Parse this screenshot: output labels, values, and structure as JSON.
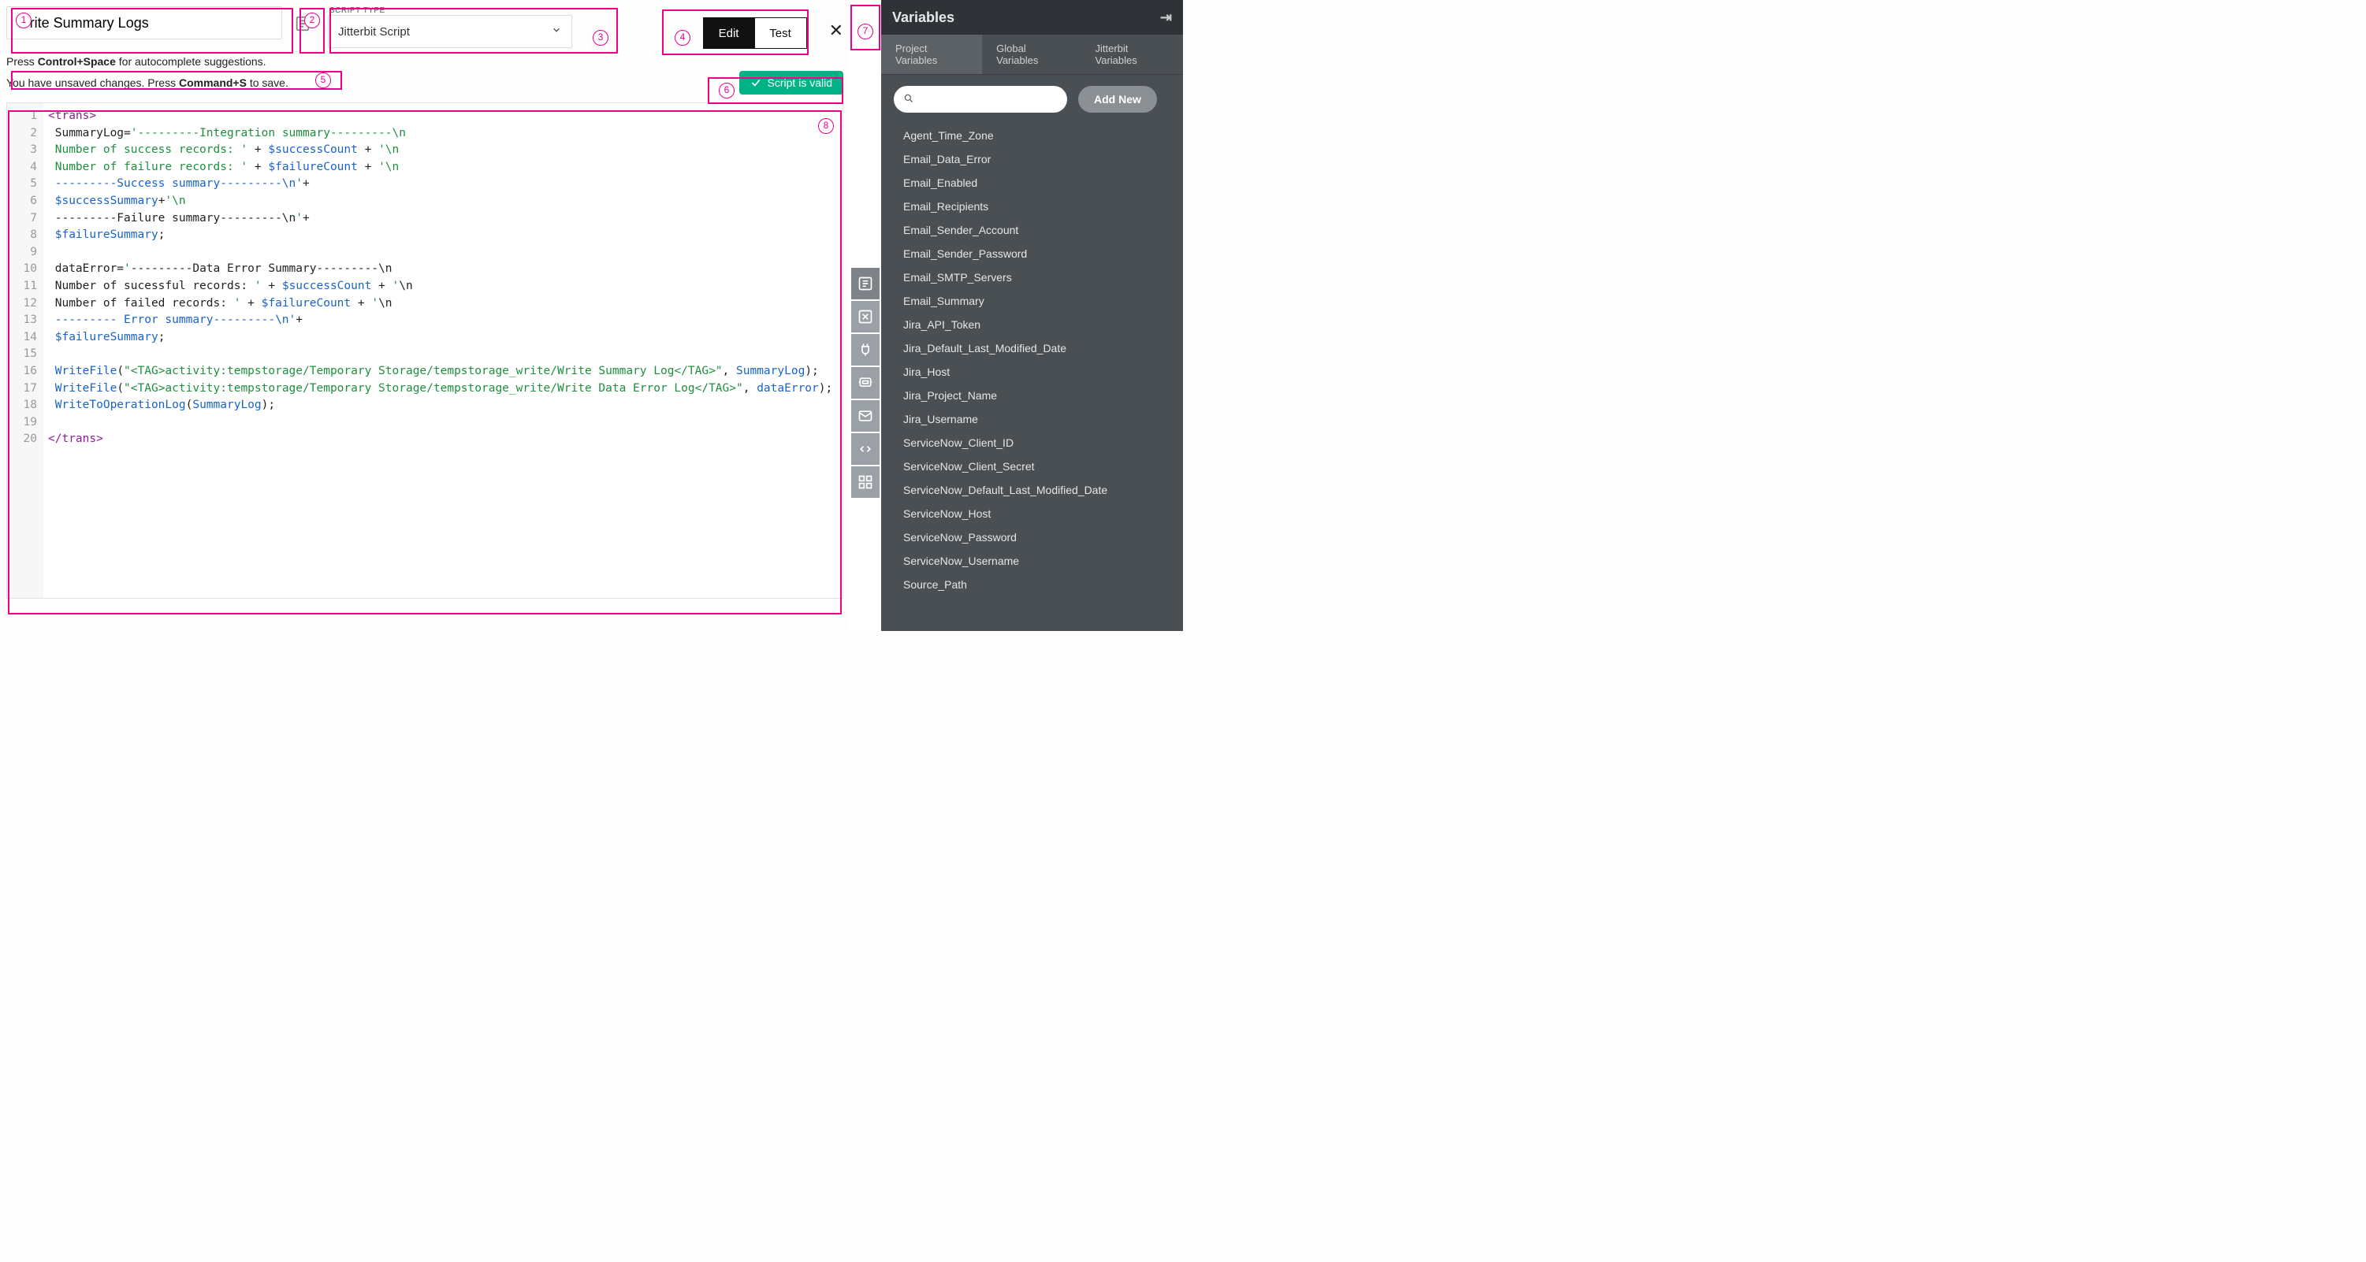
{
  "header": {
    "script_name": "Write Summary Logs",
    "script_type_label": "SCRIPT TYPE",
    "script_type_value": "Jitterbit Script",
    "edit_label": "Edit",
    "test_label": "Test"
  },
  "hints": {
    "autocomplete_pre": "Press ",
    "autocomplete_key": "Control+Space",
    "autocomplete_post": " for autocomplete suggestions.",
    "unsaved_pre": "You have unsaved changes. Press ",
    "unsaved_key": "Command+S",
    "unsaved_post": " to save."
  },
  "status": {
    "valid_text": "Script is valid"
  },
  "callouts": {
    "1": "1",
    "2": "2",
    "3": "3",
    "4": "4",
    "5": "5",
    "6": "6",
    "7": "7",
    "8": "8"
  },
  "code_lines": [
    [
      {
        "t": "tag",
        "v": "<trans>"
      }
    ],
    [
      {
        "t": "pl",
        "v": " SummaryLog="
      },
      {
        "t": "str",
        "v": "'---------Integration summary---------\\n"
      }
    ],
    [
      {
        "t": "str",
        "v": " Number of success records: '"
      },
      {
        "t": "pl",
        "v": " + "
      },
      {
        "t": "var",
        "v": "$successCount"
      },
      {
        "t": "pl",
        "v": " + "
      },
      {
        "t": "str",
        "v": "'\\n"
      }
    ],
    [
      {
        "t": "str",
        "v": " Number of failure records: '"
      },
      {
        "t": "pl",
        "v": " + "
      },
      {
        "t": "var",
        "v": "$failureCount"
      },
      {
        "t": "pl",
        "v": " + "
      },
      {
        "t": "str",
        "v": "'\\n"
      }
    ],
    [
      {
        "t": "strb",
        "v": " ---------Success summary---------\\n'"
      },
      {
        "t": "pl",
        "v": "+"
      }
    ],
    [
      {
        "t": "pl",
        "v": " "
      },
      {
        "t": "var",
        "v": "$successSummary"
      },
      {
        "t": "pl",
        "v": "+"
      },
      {
        "t": "str",
        "v": "'\\n"
      }
    ],
    [
      {
        "t": "pl",
        "v": " ---------Failure summary---------\\n"
      },
      {
        "t": "str",
        "v": "'"
      },
      {
        "t": "pl",
        "v": "+"
      }
    ],
    [
      {
        "t": "pl",
        "v": " "
      },
      {
        "t": "var",
        "v": "$failureSummary"
      },
      {
        "t": "pl",
        "v": ";"
      }
    ],
    [
      {
        "t": "pl",
        "v": ""
      }
    ],
    [
      {
        "t": "pl",
        "v": " dataError="
      },
      {
        "t": "str",
        "v": "'"
      },
      {
        "t": "pl",
        "v": "---------Data Error Summary---------\\n"
      }
    ],
    [
      {
        "t": "pl",
        "v": " Number of sucessful records: "
      },
      {
        "t": "str",
        "v": "'"
      },
      {
        "t": "pl",
        "v": " + "
      },
      {
        "t": "var",
        "v": "$successCount"
      },
      {
        "t": "pl",
        "v": " + "
      },
      {
        "t": "str",
        "v": "'"
      },
      {
        "t": "pl",
        "v": "\\n"
      }
    ],
    [
      {
        "t": "pl",
        "v": " Number of failed records: "
      },
      {
        "t": "str",
        "v": "'"
      },
      {
        "t": "pl",
        "v": " + "
      },
      {
        "t": "var",
        "v": "$failureCount"
      },
      {
        "t": "pl",
        "v": " + "
      },
      {
        "t": "str",
        "v": "'"
      },
      {
        "t": "pl",
        "v": "\\n"
      }
    ],
    [
      {
        "t": "strb",
        "v": " --------- Error summary---------\\n'"
      },
      {
        "t": "pl",
        "v": "+"
      }
    ],
    [
      {
        "t": "pl",
        "v": " "
      },
      {
        "t": "var",
        "v": "$failureSummary"
      },
      {
        "t": "pl",
        "v": ";"
      }
    ],
    [
      {
        "t": "pl",
        "v": ""
      }
    ],
    [
      {
        "t": "pl",
        "v": " "
      },
      {
        "t": "fn",
        "v": "WriteFile"
      },
      {
        "t": "pl",
        "v": "("
      },
      {
        "t": "str",
        "v": "\"<TAG>activity:tempstorage/Temporary Storage/tempstorage_write/Write Summary Log</TAG>\""
      },
      {
        "t": "pl",
        "v": ", "
      },
      {
        "t": "id",
        "v": "SummaryLog"
      },
      {
        "t": "pl",
        "v": ");"
      }
    ],
    [
      {
        "t": "pl",
        "v": " "
      },
      {
        "t": "fn",
        "v": "WriteFile"
      },
      {
        "t": "pl",
        "v": "("
      },
      {
        "t": "str",
        "v": "\"<TAG>activity:tempstorage/Temporary Storage/tempstorage_write/Write Data Error Log</TAG>\""
      },
      {
        "t": "pl",
        "v": ", "
      },
      {
        "t": "id",
        "v": "dataError"
      },
      {
        "t": "pl",
        "v": ");"
      }
    ],
    [
      {
        "t": "pl",
        "v": " "
      },
      {
        "t": "fn",
        "v": "WriteToOperationLog"
      },
      {
        "t": "pl",
        "v": "("
      },
      {
        "t": "id",
        "v": "SummaryLog"
      },
      {
        "t": "pl",
        "v": ");"
      }
    ],
    [
      {
        "t": "pl",
        "v": ""
      }
    ],
    [
      {
        "t": "tag",
        "v": "</trans>"
      }
    ]
  ],
  "variables_panel": {
    "title": "Variables",
    "tabs": [
      "Project Variables",
      "Global Variables",
      "Jitterbit Variables"
    ],
    "active_tab": 0,
    "add_new": "Add New",
    "items": [
      "Agent_Time_Zone",
      "Email_Data_Error",
      "Email_Enabled",
      "Email_Recipients",
      "Email_Sender_Account",
      "Email_Sender_Password",
      "Email_SMTP_Servers",
      "Email_Summary",
      "Jira_API_Token",
      "Jira_Default_Last_Modified_Date",
      "Jira_Host",
      "Jira_Project_Name",
      "Jira_Username",
      "ServiceNow_Client_ID",
      "ServiceNow_Client_Secret",
      "ServiceNow_Default_Last_Modified_Date",
      "ServiceNow_Host",
      "ServiceNow_Password",
      "ServiceNow_Username",
      "Source_Path"
    ]
  }
}
